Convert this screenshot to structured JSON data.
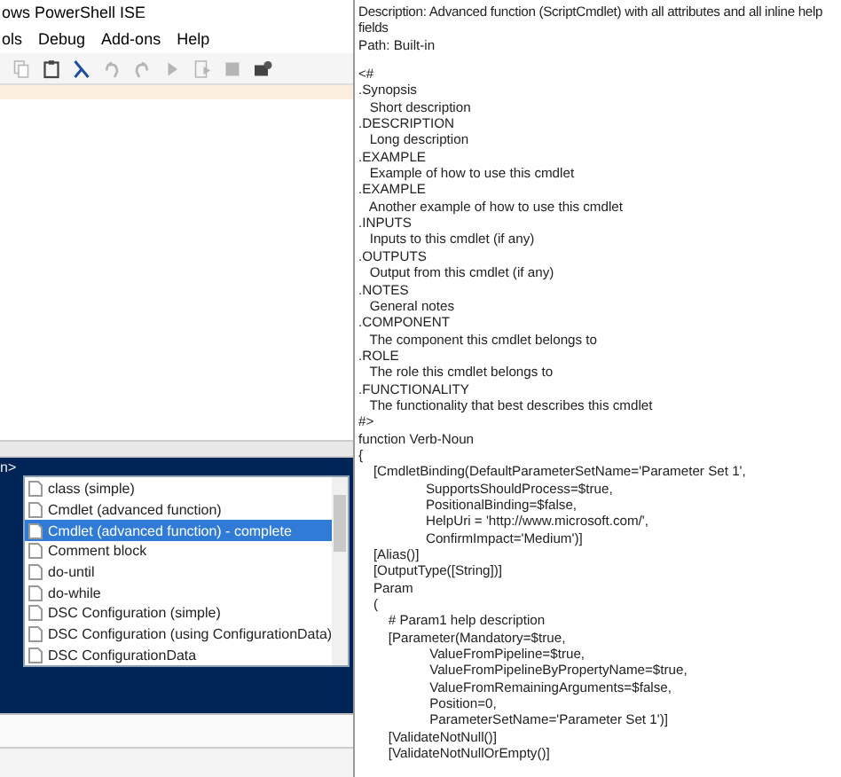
{
  "window": {
    "title": "ows PowerShell ISE"
  },
  "menu": [
    {
      "label": "ols"
    },
    {
      "label": "Debug"
    },
    {
      "label": "Add-ons"
    },
    {
      "label": "Help"
    }
  ],
  "toolbar": [
    {
      "kind": "copy",
      "disabled": true
    },
    {
      "kind": "paste",
      "disabled": false
    },
    {
      "kind": "console",
      "disabled": false
    },
    {
      "kind": "undo",
      "disabled": true
    },
    {
      "kind": "redo",
      "disabled": true
    },
    {
      "kind": "run",
      "disabled": true
    },
    {
      "kind": "run-selection",
      "disabled": true
    },
    {
      "kind": "stop",
      "disabled": true
    },
    {
      "kind": "remote",
      "disabled": false
    }
  ],
  "console": {
    "prompt": "n>"
  },
  "snippet_list": {
    "items": [
      {
        "label": "class (simple)",
        "selected": false
      },
      {
        "label": "Cmdlet (advanced function)",
        "selected": false
      },
      {
        "label": "Cmdlet (advanced function) - complete",
        "selected": true
      },
      {
        "label": "Comment block",
        "selected": false
      },
      {
        "label": "do-until",
        "selected": false
      },
      {
        "label": "do-while",
        "selected": false
      },
      {
        "label": "DSC Configuration (simple)",
        "selected": false
      },
      {
        "label": "DSC Configuration (using ConfigurationData)",
        "selected": false
      },
      {
        "label": "DSC ConfigurationData",
        "selected": false
      }
    ]
  },
  "tooltip": {
    "description": "Description: Advanced function (ScriptCmdlet) with all attributes and all inline help fields",
    "path": "Path: Built-in",
    "code": [
      "<#",
      ".Synopsis",
      "   Short description",
      ".DESCRIPTION",
      "   Long description",
      ".EXAMPLE",
      "   Example of how to use this cmdlet",
      ".EXAMPLE",
      "   Another example of how to use this cmdlet",
      ".INPUTS",
      "   Inputs to this cmdlet (if any)",
      ".OUTPUTS",
      "   Output from this cmdlet (if any)",
      ".NOTES",
      "   General notes",
      ".COMPONENT",
      "   The component this cmdlet belongs to",
      ".ROLE",
      "   The role this cmdlet belongs to",
      ".FUNCTIONALITY",
      "   The functionality that best describes this cmdlet",
      "#>",
      "function Verb-Noun",
      "{",
      "    [CmdletBinding(DefaultParameterSetName='Parameter Set 1',",
      "                  SupportsShouldProcess=$true,",
      "                  PositionalBinding=$false,",
      "                  HelpUri = 'http://www.microsoft.com/',",
      "                  ConfirmImpact='Medium')]",
      "    [Alias()]",
      "    [OutputType([String])]",
      "    Param",
      "    (",
      "        # Param1 help description",
      "        [Parameter(Mandatory=$true,",
      "                   ValueFromPipeline=$true,",
      "                   ValueFromPipelineByPropertyName=$true,",
      "                   ValueFromRemainingArguments=$false,",
      "                   Position=0,",
      "                   ParameterSetName='Parameter Set 1')]",
      "        [ValidateNotNull()]",
      "        [ValidateNotNullOrEmpty()]"
    ]
  }
}
